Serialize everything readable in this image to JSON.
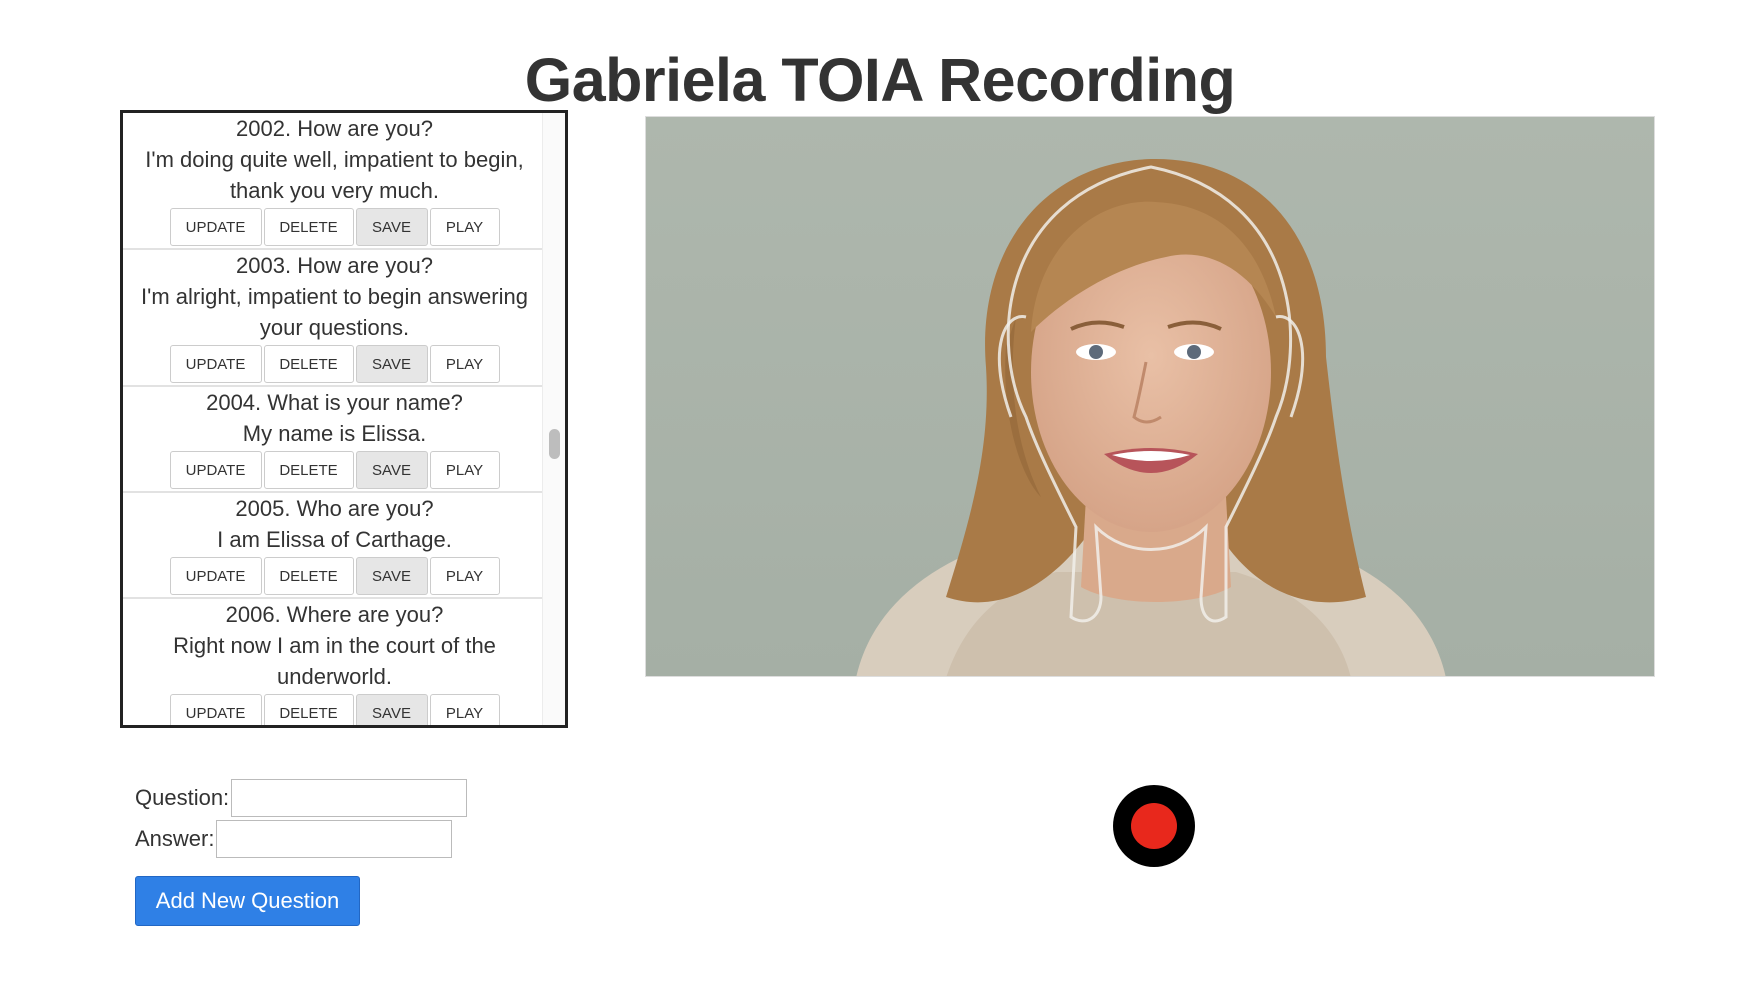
{
  "page": {
    "title": "Gabriela TOIA Recording"
  },
  "buttons": {
    "update": "UPDATE",
    "delete": "DELETE",
    "save": "SAVE",
    "play": "PLAY"
  },
  "qa_items": [
    {
      "question": "2002. How are you?",
      "answer": "I'm doing quite well, impatient to begin, thank you very much."
    },
    {
      "question": "2003. How are you?",
      "answer": "I'm alright, impatient to begin answering your questions."
    },
    {
      "question": "2004. What is your name?",
      "answer": "My name is Elissa."
    },
    {
      "question": "2005. Who are you?",
      "answer": "I am Elissa of Carthage."
    },
    {
      "question": "2006. Where are you?",
      "answer": "Right now I am in the court of the underworld."
    }
  ],
  "form": {
    "question_label": "Question:",
    "question_value": "",
    "answer_label": "Answer:",
    "answer_value": "",
    "add_button": "Add New Question"
  },
  "colors": {
    "record_red": "#e8281c",
    "primary_blue": "#2f80e6"
  }
}
